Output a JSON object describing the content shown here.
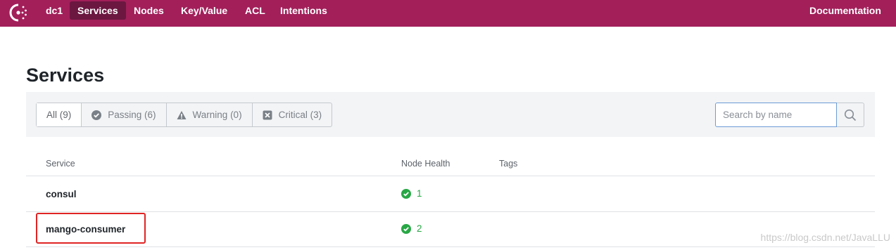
{
  "topnav": {
    "logo_icon": "consul-logo-icon",
    "items": [
      {
        "label": "dc1",
        "active": false
      },
      {
        "label": "Services",
        "active": true
      },
      {
        "label": "Nodes",
        "active": false
      },
      {
        "label": "Key/Value",
        "active": false
      },
      {
        "label": "ACL",
        "active": false
      },
      {
        "label": "Intentions",
        "active": false
      }
    ],
    "documentation": "Documentation",
    "bg_color": "#a21f5a",
    "active_color": "#6b1740"
  },
  "page": {
    "title": "Services"
  },
  "filters": [
    {
      "label": "All (9)",
      "icon": "",
      "active": true
    },
    {
      "label": "Passing (6)",
      "icon": "check-circle-icon",
      "active": false
    },
    {
      "label": "Warning (0)",
      "icon": "warning-icon",
      "active": false
    },
    {
      "label": "Critical (3)",
      "icon": "critical-x-icon",
      "active": false
    }
  ],
  "search": {
    "placeholder": "Search by name",
    "value": "",
    "icon": "search-icon"
  },
  "table": {
    "headers": {
      "service": "Service",
      "health": "Node Health",
      "tags": "Tags"
    },
    "rows": [
      {
        "name": "consul",
        "health_count": "1",
        "health_icon": "check-circle-icon",
        "tags": ""
      },
      {
        "name": "mango-consumer",
        "health_count": "2",
        "health_icon": "check-circle-icon",
        "tags": ""
      }
    ]
  },
  "watermark": "https://blog.csdn.net/JavaLLU",
  "colors": {
    "passing": "#28a745",
    "highlight": "#e02424"
  }
}
